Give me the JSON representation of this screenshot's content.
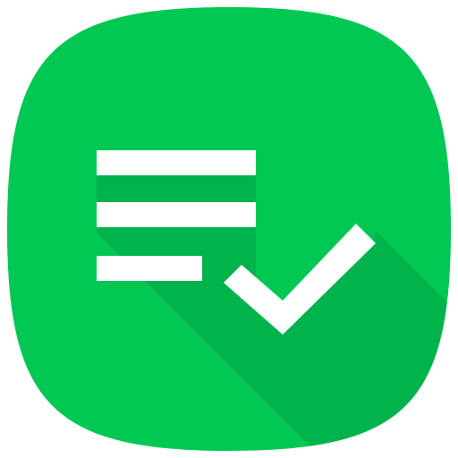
{
  "app_icon": {
    "name": "checklist-app-icon",
    "icon": "task-list-check-icon",
    "colors": {
      "background": "#00C853",
      "long_shadow": "#00A445",
      "glyph": "#FFFFFF"
    }
  }
}
